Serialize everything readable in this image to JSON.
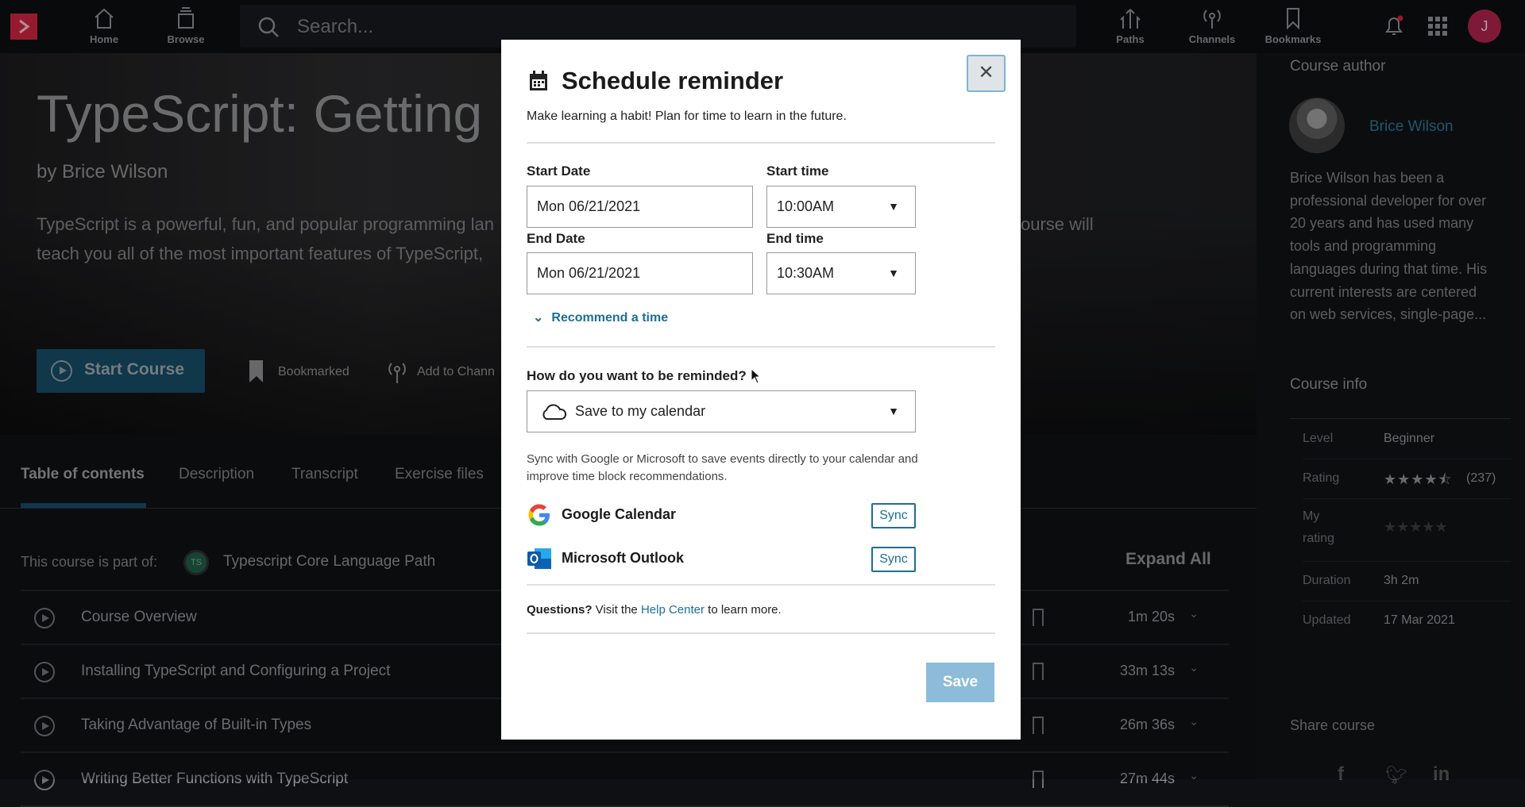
{
  "topbar": {
    "search_placeholder": "Search...",
    "nav": {
      "home": "Home",
      "browse": "Browse",
      "paths": "Paths",
      "channels": "Channels",
      "bookmarks": "Bookmarks"
    },
    "avatar_initial": "J",
    "brand_color": "#c8233f",
    "avatar_color": "#a8234a"
  },
  "hero": {
    "title": "TypeScript: Getting",
    "author_line": "by Brice Wilson",
    "description_line1": "TypeScript is a powerful, fun, and popular programming lan",
    "description_line1_end": "ourse will",
    "description_line2": "teach you all of the most important features of TypeScript,",
    "start_label": "Start Course",
    "bookmarked_label": "Bookmarked",
    "add_channel_label": "Add to Chann"
  },
  "tabs": [
    {
      "label": "Table of contents",
      "active": true
    },
    {
      "label": "Description"
    },
    {
      "label": "Transcript"
    },
    {
      "label": "Exercise files"
    }
  ],
  "path": {
    "prefix": "This course is part of:",
    "badge": "TS",
    "name": "Typescript Core Language Path"
  },
  "expand_all": "Expand All",
  "modules": [
    {
      "title": "Course Overview",
      "duration": "1m 20s"
    },
    {
      "title": "Installing TypeScript and Configuring a Project",
      "duration": "33m 13s"
    },
    {
      "title": "Taking Advantage of Built-in Types",
      "duration": "26m 36s"
    },
    {
      "title": "Writing Better Functions with TypeScript",
      "duration": "27m 44s"
    }
  ],
  "sidebar": {
    "author_heading": "Course author",
    "author_name": "Brice Wilson",
    "bio": [
      "Brice Wilson has been a",
      "professional developer for over",
      "20 years and has used many",
      "tools and programming",
      "languages during that time. His",
      "current interests are centered",
      "on web services, single-page..."
    ],
    "info_heading": "Course info",
    "level_label": "Level",
    "level": "Beginner",
    "rating_label": "Rating",
    "rating": 4.5,
    "rating_count": "(237)",
    "my_rating_label": [
      "My",
      "rating"
    ],
    "my_rating": 0,
    "duration_label": "Duration",
    "duration": "3h 2m",
    "updated_label": "Updated",
    "updated": "17 Mar 2021",
    "share_heading": "Share course"
  },
  "modal": {
    "title": "Schedule reminder",
    "subtitle": "Make learning a habit! Plan for time to learn in the future.",
    "start_date_label": "Start Date",
    "start_date": "Mon 06/21/2021",
    "start_time_label": "Start time",
    "start_time": "10:00AM",
    "end_date_label": "End Date",
    "end_date": "Mon 06/21/2021",
    "end_time_label": "End time",
    "end_time": "10:30AM",
    "recommend": "Recommend a time",
    "remind_label": "How do you want to be reminded?",
    "remind_value": "Save to my calendar",
    "sync_text1": "Sync with Google or Microsoft to save events directly to your calendar and",
    "sync_text2": "improve time block recommendations.",
    "google": "Google Calendar",
    "outlook": "Microsoft Outlook",
    "sync": "Sync",
    "questions_bold": "Questions?",
    "questions_pre": " Visit the ",
    "help_link": "Help Center",
    "questions_post": " to learn more.",
    "save": "Save",
    "accent": "#1d6f9a"
  }
}
